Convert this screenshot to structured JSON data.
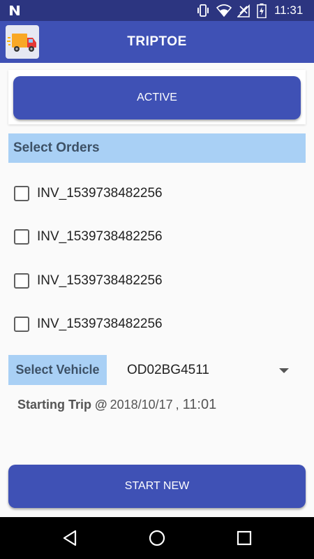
{
  "status_bar": {
    "time": "11:31",
    "icons": [
      "n-notification-icon",
      "vibrate-icon",
      "wifi-icon",
      "signal-icon",
      "battery-icon"
    ]
  },
  "app_bar": {
    "title": "TRIPTOE",
    "logo_icon": "delivery-truck-icon"
  },
  "buttons": {
    "active": "ACTIVE",
    "start_new": "START NEW"
  },
  "orders": {
    "header": "Select Orders",
    "items": [
      {
        "label": "INV_1539738482256",
        "checked": false
      },
      {
        "label": "INV_1539738482256",
        "checked": false
      },
      {
        "label": "INV_1539738482256",
        "checked": false
      },
      {
        "label": "INV_1539738482256",
        "checked": false
      }
    ]
  },
  "vehicle": {
    "label": "Select Vehicle",
    "selected": "OD02BG4511"
  },
  "trip": {
    "label": "Starting Trip @",
    "date": "2018/10/17",
    "separator": ",",
    "time": "11:01"
  },
  "colors": {
    "primary": "#3f51b5",
    "primary_dark": "#2c3580",
    "section_bg": "#a9d0f5",
    "section_text": "#3d5166"
  }
}
